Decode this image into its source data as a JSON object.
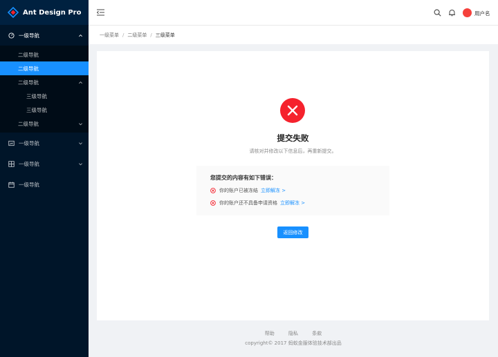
{
  "logo": {
    "text": "Ant Design Pro"
  },
  "sidebar": {
    "items": [
      {
        "label": "一级导航",
        "icon": "dashboard-icon",
        "open": true
      },
      {
        "label": "二级导航"
      },
      {
        "label": "二级导航",
        "selected": true
      },
      {
        "label": "二级导航",
        "open": true
      },
      {
        "label": "三级导航"
      },
      {
        "label": "三级导航"
      },
      {
        "label": "二级导航"
      },
      {
        "label": "一级导航",
        "icon": "form-icon"
      },
      {
        "label": "一级导航",
        "icon": "table-icon"
      },
      {
        "label": "一级导航",
        "icon": "calendar-icon"
      }
    ]
  },
  "header": {
    "username": "用户名"
  },
  "breadcrumb": [
    "一级菜单",
    "二级菜单",
    "三级菜单"
  ],
  "result": {
    "title": "提交失败",
    "description": "请核对并修改以下信息后，再重新提交。",
    "extra_title": "您提交的内容有如下错误：",
    "errors": [
      {
        "text": "你的账户已被冻结",
        "link": "立即解冻 >"
      },
      {
        "text": "你的账户还不具备申请资格",
        "link": "立即解冻 >"
      }
    ],
    "button": "返回修改"
  },
  "footer": {
    "links": [
      "帮助",
      "隐私",
      "条款"
    ],
    "copyright": "copyright© 2017 蚂蚁金服体验技术部出品"
  },
  "colors": {
    "sider_bg": "#001529",
    "primary": "#1890ff",
    "error": "#f5222d"
  }
}
